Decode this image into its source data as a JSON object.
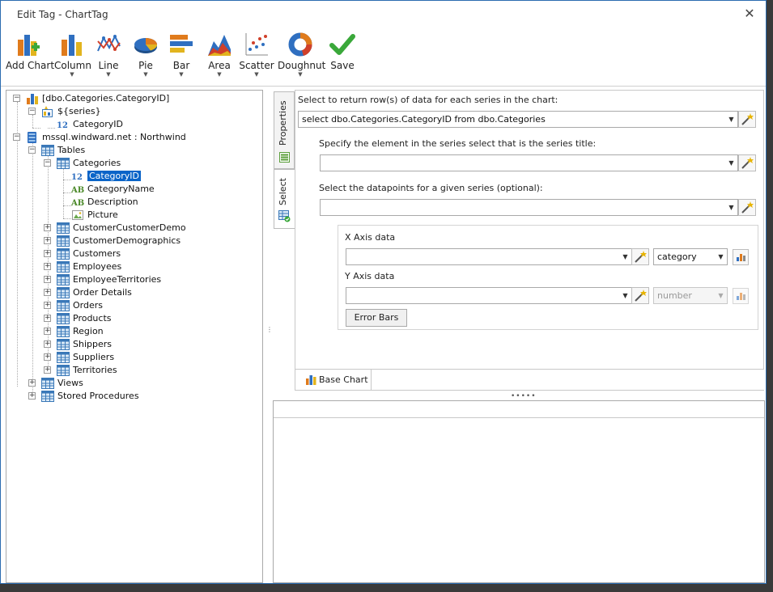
{
  "window": {
    "title": "Edit Tag - ChartTag",
    "close_glyph": "✕"
  },
  "ribbon": {
    "buttons": [
      {
        "label": "Add Chart",
        "icon": "add-chart-icon",
        "has_dropdown": false
      },
      {
        "label": "Column",
        "icon": "column-chart-icon",
        "has_dropdown": true
      },
      {
        "label": "Line",
        "icon": "line-chart-icon",
        "has_dropdown": true
      },
      {
        "label": "Pie",
        "icon": "pie-chart-icon",
        "has_dropdown": true
      },
      {
        "label": "Bar",
        "icon": "bar-chart-icon",
        "has_dropdown": true
      },
      {
        "label": "Area",
        "icon": "area-chart-icon",
        "has_dropdown": true
      },
      {
        "label": "Scatter",
        "icon": "scatter-chart-icon",
        "has_dropdown": true
      },
      {
        "label": "Doughnut",
        "icon": "doughnut-chart-icon",
        "has_dropdown": true
      },
      {
        "label": "Save",
        "icon": "save-check-icon",
        "has_dropdown": false
      }
    ],
    "dropdown_glyph": "▼"
  },
  "tree": {
    "root_tag": "[dbo.Categories.CategoryID]",
    "series_var": "${series}",
    "series_child": "CategoryID",
    "datasource": "mssql.windward.net : Northwind",
    "tables_label": "Tables",
    "categories_label": "Categories",
    "columns": [
      {
        "type_glyph": "12",
        "name": "CategoryID",
        "selected": true
      },
      {
        "type_glyph": "AB",
        "name": "CategoryName",
        "selected": false
      },
      {
        "type_glyph": "AB",
        "name": "Description",
        "selected": false
      },
      {
        "type_glyph": "img",
        "name": "Picture",
        "selected": false
      }
    ],
    "tables": [
      "CustomerCustomerDemo",
      "CustomerDemographics",
      "Customers",
      "Employees",
      "EmployeeTerritories",
      "Order Details",
      "Orders",
      "Products",
      "Region",
      "Shippers",
      "Suppliers",
      "Territories"
    ],
    "views_label": "Views",
    "procs_label": "Stored Procedures",
    "collapse_glyph": "−",
    "expand_glyph": "+"
  },
  "sidetabs": {
    "properties": "Properties",
    "select": "Select"
  },
  "form": {
    "rows_label": "Select to return row(s) of data for each series in the chart:",
    "rows_value": "select dbo.Categories.CategoryID from dbo.Categories",
    "title_label": "Specify the element in the series select that is the series title:",
    "title_value": "",
    "points_label": "Select the datapoints for a given series (optional):",
    "points_value": "",
    "x_label": "X Axis data",
    "x_value": "",
    "x_type": "category",
    "y_label": "Y Axis data",
    "y_value": "",
    "y_type": "number",
    "error_bars": "Error Bars",
    "combo_glyph": "▼"
  },
  "bottom": {
    "tab_label": "Base Chart",
    "splitter_dots": "•••••",
    "v_splitter_dots": "⋮"
  }
}
